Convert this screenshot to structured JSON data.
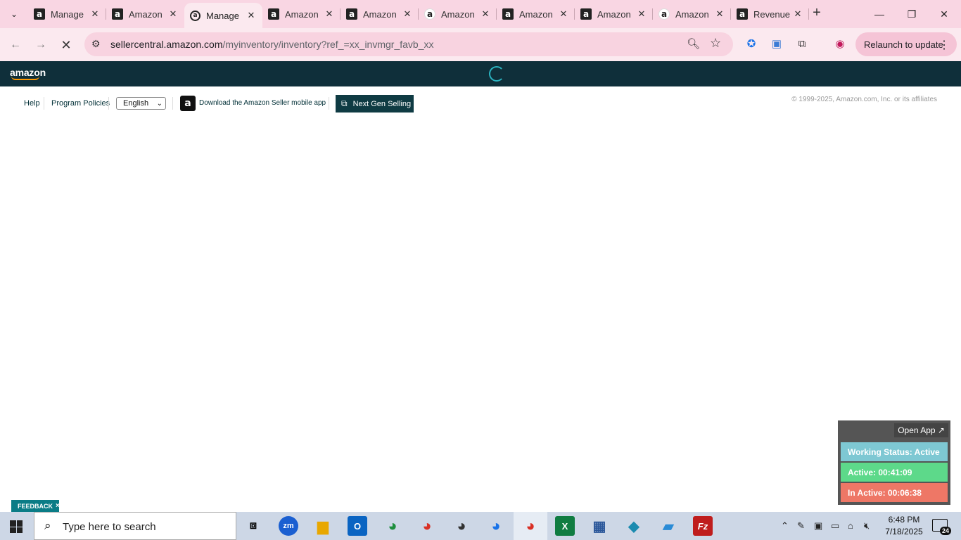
{
  "browser": {
    "tabs": [
      {
        "title": "Manage",
        "favicon": "a",
        "active": false
      },
      {
        "title": "Amazon",
        "favicon": "a",
        "active": false
      },
      {
        "title": "Manage",
        "favicon": "a",
        "active": true
      },
      {
        "title": "Amazon",
        "favicon": "a",
        "active": false
      },
      {
        "title": "Amazon",
        "favicon": "a",
        "active": false
      },
      {
        "title": "Amazon",
        "favicon": "a",
        "active": false
      },
      {
        "title": "Amazon",
        "favicon": "a",
        "active": false
      },
      {
        "title": "Amazon",
        "favicon": "a",
        "active": false
      },
      {
        "title": "Amazon",
        "favicon": "a",
        "active": false
      },
      {
        "title": "Revenue",
        "favicon": "a",
        "active": false
      }
    ],
    "url_host": "sellercentral.amazon.com",
    "url_path": "/myinventory/inventory?ref_=xx_invmgr_favb_xx",
    "relaunch_label": "Relaunch to update"
  },
  "amazon": {
    "logo": "amazon",
    "links": {
      "help": "Help",
      "program_policies": "Program Policies",
      "language": "English",
      "download_app": "Download the Amazon Seller mobile app",
      "next_gen": "Next Gen Selling"
    },
    "copyright": "© 1999-2025, Amazon.com, Inc. or its affiliates",
    "feedback": "FEEDBACK"
  },
  "widget": {
    "open_app": "Open App ↗",
    "working_status": "Working Status: Active",
    "active": "Active: 00:41:09",
    "inactive": "In Active: 00:06:38",
    "colors": {
      "status": "#7ec8d3",
      "active": "#5dd98a",
      "inactive": "#ee7766"
    }
  },
  "taskbar": {
    "search_placeholder": "Type here to search",
    "time": "6:48 PM",
    "date": "7/18/2025",
    "notifications": "24"
  }
}
